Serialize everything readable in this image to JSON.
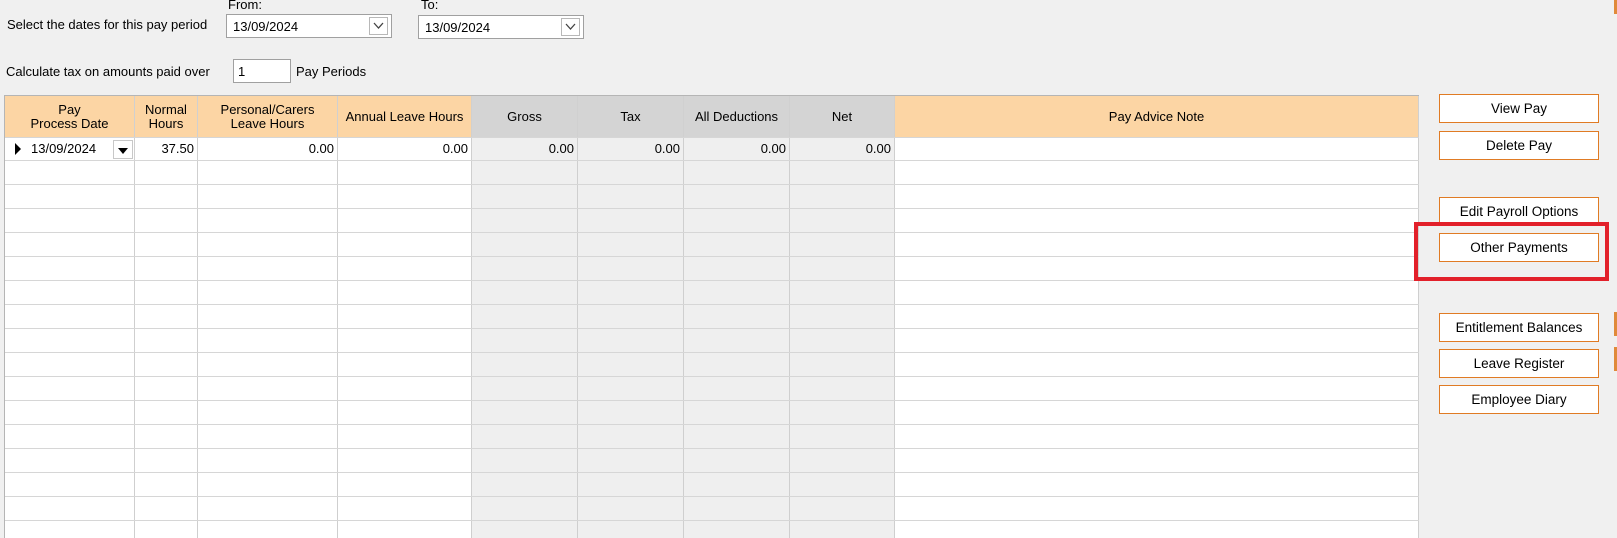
{
  "period": {
    "label": "Select the dates for this pay period",
    "from_label": "From:",
    "to_label": "To:",
    "from_value": "13/09/2024",
    "to_value": "13/09/2024"
  },
  "tax": {
    "label_before": "Calculate tax on amounts paid over",
    "periods_value": "1",
    "label_after": "Pay Periods"
  },
  "grid": {
    "headers": {
      "date_l1": "Pay",
      "date_l2": "Process Date",
      "normal_l1": "Normal",
      "normal_l2": "Hours",
      "personal_l1": "Personal/Carers",
      "personal_l2": "Leave Hours",
      "annual": "Annual Leave Hours",
      "gross": "Gross",
      "tax": "Tax",
      "deductions": "All Deductions",
      "net": "Net",
      "note": "Pay Advice Note"
    },
    "row1": {
      "date": "13/09/2024",
      "normal": "37.50",
      "personal": "0.00",
      "annual": "0.00",
      "gross": "0.00",
      "tax": "0.00",
      "deductions": "0.00",
      "net": "0.00",
      "note": ""
    }
  },
  "buttons": {
    "view_pay": "View Pay",
    "delete_pay": "Delete Pay",
    "edit_payroll_options": "Edit Payroll Options",
    "other_payments": "Other Payments",
    "entitlement_balances": "Entitlement Balances",
    "leave_register": "Leave Register",
    "employee_diary": "Employee Diary"
  },
  "colors": {
    "header_orange": "#fcd5a4",
    "header_grey": "#d4d4d4",
    "button_border": "#e07b24",
    "highlight_red": "#e2202a"
  }
}
